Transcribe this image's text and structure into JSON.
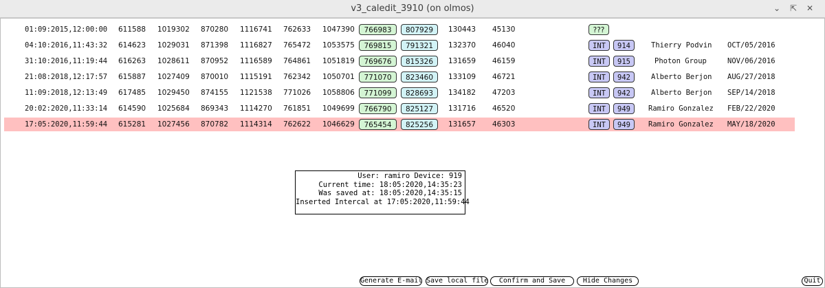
{
  "window": {
    "title": "v3_caledit_3910 (on olmos)"
  },
  "rows": [
    {
      "date": "01:09:2015,12:00:00",
      "v1": "611588",
      "v2": "1019302",
      "v3": "870280",
      "v4": "1116741",
      "v5": "762633",
      "v6": "1047390",
      "g": "766983",
      "c": "807929",
      "v7": "130443",
      "v8": "45130",
      "type": "???",
      "num": "",
      "who": "",
      "day": ""
    },
    {
      "date": "04:10:2016,11:43:32",
      "v1": "614623",
      "v2": "1029031",
      "v3": "871398",
      "v4": "1116827",
      "v5": "765472",
      "v6": "1053575",
      "g": "769815",
      "c": "791321",
      "v7": "132370",
      "v8": "46040",
      "type": "INT",
      "num": "914",
      "who": "Thierry Podvin",
      "day": "OCT/05/2016"
    },
    {
      "date": "31:10:2016,11:19:44",
      "v1": "616263",
      "v2": "1028611",
      "v3": "870952",
      "v4": "1116589",
      "v5": "764861",
      "v6": "1051819",
      "g": "769676",
      "c": "815326",
      "v7": "131659",
      "v8": "46159",
      "type": "INT",
      "num": "915",
      "who": "Photon Group",
      "day": "NOV/06/2016"
    },
    {
      "date": "21:08:2018,12:17:57",
      "v1": "615887",
      "v2": "1027409",
      "v3": "870010",
      "v4": "1115191",
      "v5": "762342",
      "v6": "1050701",
      "g": "771070",
      "c": "823460",
      "v7": "133109",
      "v8": "46721",
      "type": "INT",
      "num": "942",
      "who": "Alberto Berjon",
      "day": "AUG/27/2018"
    },
    {
      "date": "11:09:2018,12:13:49",
      "v1": "617485",
      "v2": "1029450",
      "v3": "874155",
      "v4": "1121538",
      "v5": "771026",
      "v6": "1058806",
      "g": "771099",
      "c": "828693",
      "v7": "134182",
      "v8": "47203",
      "type": "INT",
      "num": "942",
      "who": "Alberto Berjon",
      "day": "SEP/14/2018"
    },
    {
      "date": "20:02:2020,11:33:14",
      "v1": "614590",
      "v2": "1025684",
      "v3": "869343",
      "v4": "1114270",
      "v5": "761851",
      "v6": "1049699",
      "g": "766790",
      "c": "825127",
      "v7": "131716",
      "v8": "46520",
      "type": "INT",
      "num": "949",
      "who": "Ramiro Gonzalez",
      "day": "FEB/22/2020"
    },
    {
      "date": "17:05:2020,11:59:44",
      "v1": "615281",
      "v2": "1027456",
      "v3": "870782",
      "v4": "1114314",
      "v5": "762622",
      "v6": "1046629",
      "g": "765454",
      "c": "825256",
      "v7": "131657",
      "v8": "46303",
      "type": "INT",
      "num": "949",
      "who": "Ramiro Gonzalez",
      "day": "MAY/18/2020"
    }
  ],
  "info": {
    "line1": "User: ramiro Device: 919",
    "line2": "Current time: 18:05:2020,14:35:23",
    "line3": "Was saved at: 18:05:2020,14:35:15",
    "line4": "Inserted Intercal at 17:05:2020,11:59:44"
  },
  "buttons": {
    "email": "Generate E-mail",
    "savelocal": "Save local file",
    "confirm": "Confirm and Save",
    "hide": "Hide Changes",
    "quit": "Quit"
  },
  "colors": {
    "selected_row": "#ffc0c0",
    "green_box": "#d4f5d4",
    "cyan_box": "#d2f3f6",
    "type_box": "#c8c8f5"
  }
}
